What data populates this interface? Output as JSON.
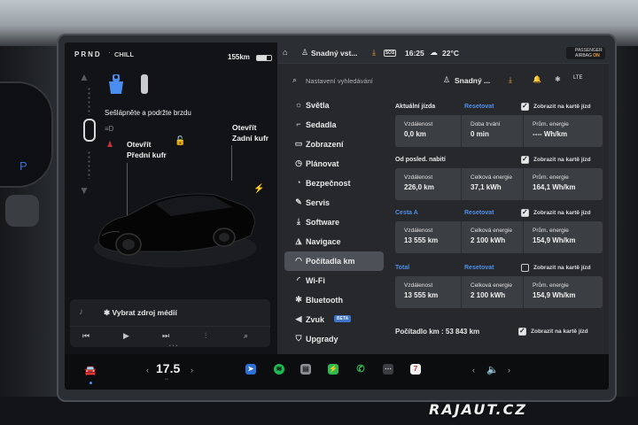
{
  "left_panel": {
    "gear": "PRND",
    "drive_mode": "CHILL",
    "range": "155km",
    "battery_level": 0.7,
    "brake_message": "Sešlápněte a podržte brzdu",
    "open_front": [
      "Otevřít",
      "Přední kufr"
    ],
    "open_trunk": [
      "Otevřít",
      "Zadní kufr"
    ]
  },
  "media": {
    "source_label": "✱ Vybrat zdroj médií"
  },
  "status_bar": {
    "profile": "Snadný vst...",
    "time": "16:25",
    "temperature": "22°C",
    "sos": "SOS",
    "airbag_line1": "PASSENGER",
    "airbag_line2": "AIRBAG",
    "airbag_state": "ON"
  },
  "search": {
    "placeholder": "Nastavení vyhledávání",
    "profile": "Snadný ...",
    "lte": "LTE"
  },
  "menu": {
    "items": [
      {
        "label": "Světla",
        "icon": "☼"
      },
      {
        "label": "Sedadla",
        "icon": "⌐"
      },
      {
        "label": "Zobrazení",
        "icon": "▭"
      },
      {
        "label": "Plánovat",
        "icon": "◷"
      },
      {
        "label": "Bezpečnost",
        "icon": "◔"
      },
      {
        "label": "Servis",
        "icon": "✎"
      },
      {
        "label": "Software",
        "icon": "⤓"
      },
      {
        "label": "Navigace",
        "icon": "◮"
      },
      {
        "label": "Počítadla km",
        "icon": "◠"
      },
      {
        "label": "Wi-Fi",
        "icon": "◜"
      },
      {
        "label": "Bluetooth",
        "icon": "✱"
      },
      {
        "label": "Zvuk",
        "icon": "◀"
      },
      {
        "label": "Upgrady",
        "icon": "⛉"
      }
    ],
    "active_index": 8,
    "zvuk_badge": "BETA"
  },
  "trips": {
    "current": {
      "name": "Aktuální jízda",
      "reset": "Resetovat",
      "checkbox_label": "Zobrazit na kartě jízd",
      "cells": [
        {
          "label": "Vzdálenost",
          "value": "0,0 km"
        },
        {
          "label": "Doba trvání",
          "value": "0 min"
        },
        {
          "label": "Prům. energie",
          "value": "---- Wh/km"
        }
      ]
    },
    "since_charge": {
      "name": "Od posled. nabití",
      "checkbox_label": "Zobrazit na kartě jízd",
      "cells": [
        {
          "label": "Vzdálenost",
          "value": "226,0 km"
        },
        {
          "label": "Celková energie",
          "value": "37,1 kWh"
        },
        {
          "label": "Prům. energie",
          "value": "164,1 Wh/km"
        }
      ]
    },
    "trip_a": {
      "name": "Cesta A",
      "reset": "Resetovat",
      "checkbox_label": "Zobrazit na kartě jízd",
      "cells": [
        {
          "label": "Vzdálenost",
          "value": "13 555 km"
        },
        {
          "label": "Celková energie",
          "value": "2 100 kWh"
        },
        {
          "label": "Prům. energie",
          "value": "154,9 Wh/km"
        }
      ]
    },
    "total": {
      "name": "Total",
      "reset": "Resetovat",
      "checkbox_label": "Zobrazit na kartě jízd",
      "cells": [
        {
          "label": "Vzdálenost",
          "value": "13 555 km"
        },
        {
          "label": "Celková energie",
          "value": "2 100 kWh"
        },
        {
          "label": "Prům. energie",
          "value": "154,9 Wh/km"
        }
      ]
    }
  },
  "odometer": {
    "text": "Počítadlo km : 53 843 km",
    "checkbox_label": "Zobrazit na kartě jízd"
  },
  "dock": {
    "temperature": "17.5",
    "calendar_day": "7"
  },
  "watermark": "RAJAUT.CZ",
  "colors": {
    "accent": "#4f8fe6",
    "warning": "#f0a23a",
    "alert": "#c03535"
  }
}
